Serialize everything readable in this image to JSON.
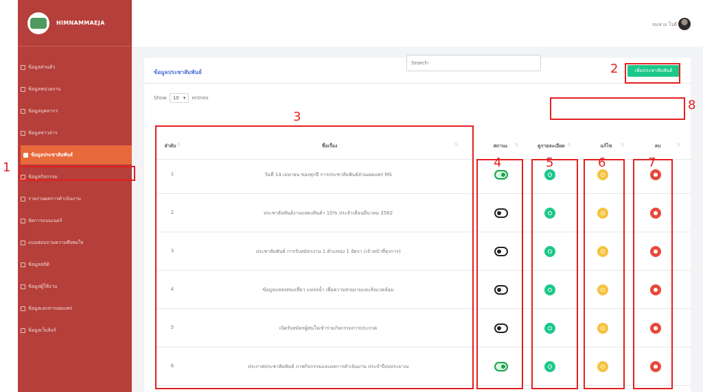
{
  "brand": {
    "name": "HIMNAMMAEJA"
  },
  "sidebar": {
    "items": [
      {
        "label": "ข้อมูลส่วนตัว",
        "active": false
      },
      {
        "label": "ข้อมูลหน่วยงาน",
        "active": false
      },
      {
        "label": "ข้อมูลบุคลากร",
        "active": false
      },
      {
        "label": "ข้อมูลข่าวสาร",
        "active": false
      },
      {
        "label": "ข้อมูลประชาสัมพันธ์",
        "active": true
      },
      {
        "label": "ข้อมูลกิจกรรม",
        "active": false
      },
      {
        "label": "รายงานผลการดำเนินงาน",
        "active": false
      },
      {
        "label": "จัดการแบนเนอร์",
        "active": false
      },
      {
        "label": "แบบสอบถามความพึงพอใจ",
        "active": false
      },
      {
        "label": "ข้อมูลสถิติ",
        "active": false
      },
      {
        "label": "ข้อมูลผู้ใช้งาน",
        "active": false
      },
      {
        "label": "ข้อมูลเอกสารเผยแพร่",
        "active": false
      },
      {
        "label": "ข้อมูลเว็บลิงก์",
        "active": false
      }
    ]
  },
  "topbar": {
    "user_name": "สมชาย ใจดี"
  },
  "card": {
    "title": "ข้อมูลประชาสัมพันธ์",
    "add_button": "เพิ่มประชาสัมพันธ์"
  },
  "table_controls": {
    "show_label": "Show",
    "entries_value": "10",
    "entries_label": "entries",
    "search_placeholder": "Search:"
  },
  "table": {
    "columns": [
      "ลำดับ",
      "ชื่อเรื่อง",
      "สถานะ",
      "ดูรายละเอียด",
      "แก้ไข",
      "ลบ"
    ],
    "rows": [
      {
        "no": "1",
        "title": "วันที่ 14 เมษายน ของทุกปี การประชาสัมพันธ์ส่วนเผยแพร่ MS",
        "status_on": true
      },
      {
        "no": "2",
        "title": "ประชาสัมพันธ์งานแสดงสินค้า 10% ประจำเดือนมีนาคม 2562",
        "status_on": false
      },
      {
        "no": "3",
        "title": "ประชาสัมพันธ์ การรับสมัครงาน 1 ตำแหน่ง 1 อัตรา (เจ้าหน้าที่ธุรการ)",
        "status_on": false
      },
      {
        "no": "4",
        "title": "ข้อมูลแหล่งท่องเที่ยว แหล่งน้ำ เพื่อความสวยงามและสิ่งแวดล้อม",
        "status_on": false
      },
      {
        "no": "5",
        "title": "เปิดรับสมัครผู้สนใจเข้าร่วมกิจกรรมการประกวด",
        "status_on": false
      },
      {
        "no": "6",
        "title": "ประกาศประชาสัมพันธ์ ภาพกิจกรรมและผลการดำเนินงาน ประจำปีงบประมาณ",
        "status_on": true
      }
    ]
  },
  "annotations": [
    "1",
    "2",
    "3",
    "4",
    "5",
    "6",
    "7",
    "8"
  ],
  "colors": {
    "sidebar": "#b53f3a",
    "active_item": "#e8693c",
    "add_button": "#1cc88a",
    "view_icon": "#1cc88a",
    "edit_icon": "#f6c23e",
    "delete_icon": "#e74a3b",
    "annotation": "#e41e1e"
  }
}
